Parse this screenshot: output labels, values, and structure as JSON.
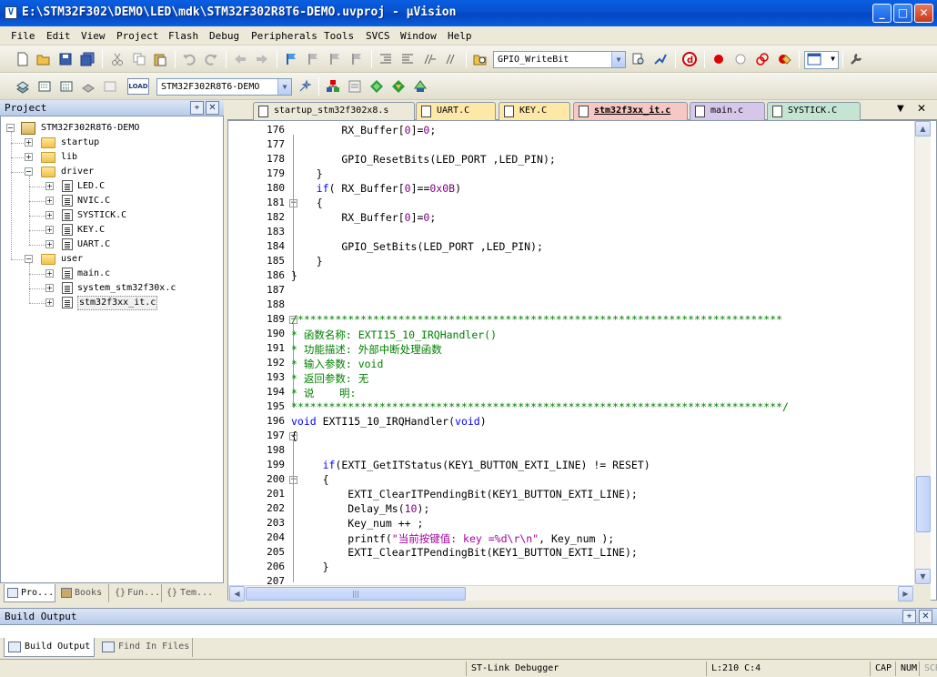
{
  "window": {
    "title": "E:\\STM32F302\\DEMO\\LED\\mdk\\STM32F302R8T6-DEMO.uvproj - µVision",
    "icon_letter": "V"
  },
  "menu": {
    "items": [
      {
        "label": "File"
      },
      {
        "label": "Edit"
      },
      {
        "label": "View"
      },
      {
        "label": "Project"
      },
      {
        "label": "Flash"
      },
      {
        "label": "Debug"
      },
      {
        "label": "Peripherals"
      },
      {
        "label": "Tools"
      },
      {
        "label": "SVCS"
      },
      {
        "label": "Window"
      },
      {
        "label": "Help"
      }
    ]
  },
  "toolbar": {
    "find_combo": "GPIO_WriteBit",
    "target_combo": "STM32F302R8T6-DEMO",
    "load_label": "LOAD"
  },
  "project_panel": {
    "title": "Project",
    "tree": {
      "root": "STM32F302R8T6-DEMO",
      "groups": [
        {
          "name": "startup",
          "expanded": false,
          "files": []
        },
        {
          "name": "lib",
          "expanded": false,
          "files": []
        },
        {
          "name": "driver",
          "expanded": true,
          "files": [
            "LED.C",
            "NVIC.C",
            "SYSTICK.C",
            "KEY.C",
            "UART.C"
          ]
        },
        {
          "name": "user",
          "expanded": true,
          "files": [
            "main.c",
            "system_stm32f30x.c",
            "stm32f3xx_it.c"
          ]
        }
      ]
    },
    "tabs": [
      {
        "label": "Pro..."
      },
      {
        "label": "Books"
      },
      {
        "label": "Fun..."
      },
      {
        "label": "Tem..."
      }
    ]
  },
  "editor": {
    "tabs": [
      {
        "label": "startup_stm32f302x8.s",
        "color": "#ece9d8"
      },
      {
        "label": "UART.C",
        "color": "#fde8a8"
      },
      {
        "label": "KEY.C",
        "color": "#fde8a8"
      },
      {
        "label": "stm32f3xx_it.c",
        "color": "#f7c7c3"
      },
      {
        "label": "main.c",
        "color": "#d6c7ea"
      },
      {
        "label": "SYSTICK.C",
        "color": "#c5e4d2"
      }
    ],
    "lines": [
      {
        "n": "176",
        "fold": "",
        "segs": [
          [
            "t",
            "        RX_Buffer["
          ],
          [
            "num",
            "0"
          ],
          [
            "t",
            "]="
          ],
          [
            "num",
            "0"
          ],
          [
            "t",
            ";"
          ]
        ]
      },
      {
        "n": "177",
        "fold": "",
        "segs": []
      },
      {
        "n": "178",
        "fold": "",
        "segs": [
          [
            "t",
            "        GPIO_ResetBits(LED_PORT ,LED_PIN);"
          ]
        ]
      },
      {
        "n": "179",
        "fold": "",
        "segs": [
          [
            "t",
            "    }"
          ]
        ]
      },
      {
        "n": "180",
        "fold": "",
        "segs": [
          [
            "t",
            "    "
          ],
          [
            "kw",
            "if"
          ],
          [
            "t",
            "( RX_Buffer["
          ],
          [
            "num",
            "0"
          ],
          [
            "t",
            "]=="
          ],
          [
            "num",
            "0x0B"
          ],
          [
            "t",
            ")"
          ]
        ]
      },
      {
        "n": "181",
        "fold": "-",
        "segs": [
          [
            "t",
            "    {"
          ]
        ]
      },
      {
        "n": "182",
        "fold": "",
        "segs": [
          [
            "t",
            "        RX_Buffer["
          ],
          [
            "num",
            "0"
          ],
          [
            "t",
            "]="
          ],
          [
            "num",
            "0"
          ],
          [
            "t",
            ";"
          ]
        ]
      },
      {
        "n": "183",
        "fold": "",
        "segs": []
      },
      {
        "n": "184",
        "fold": "",
        "segs": [
          [
            "t",
            "        GPIO_SetBits(LED_PORT ,LED_PIN);"
          ]
        ]
      },
      {
        "n": "185",
        "fold": "",
        "segs": [
          [
            "t",
            "    }"
          ]
        ]
      },
      {
        "n": "186",
        "fold": "",
        "segs": [
          [
            "t",
            "}"
          ]
        ]
      },
      {
        "n": "187",
        "fold": "",
        "segs": []
      },
      {
        "n": "188",
        "fold": "",
        "segs": []
      },
      {
        "n": "189",
        "fold": "-",
        "segs": [
          [
            "cm",
            "/*****************************************************************************"
          ]
        ]
      },
      {
        "n": "190",
        "fold": "",
        "segs": [
          [
            "cm",
            "* 函数名称: EXTI15_10_IRQHandler()"
          ]
        ]
      },
      {
        "n": "191",
        "fold": "",
        "segs": [
          [
            "cm",
            "* 功能描述: 外部中断处理函数"
          ]
        ]
      },
      {
        "n": "192",
        "fold": "",
        "segs": [
          [
            "cm",
            "* 输入参数: void"
          ]
        ]
      },
      {
        "n": "193",
        "fold": "",
        "segs": [
          [
            "cm",
            "* 返回参数: 无"
          ]
        ]
      },
      {
        "n": "194",
        "fold": "",
        "segs": [
          [
            "cm",
            "* 说    明:"
          ]
        ]
      },
      {
        "n": "195",
        "fold": "",
        "segs": [
          [
            "cm",
            "******************************************************************************/"
          ]
        ]
      },
      {
        "n": "196",
        "fold": "",
        "segs": [
          [
            "kw",
            "void"
          ],
          [
            "t",
            " EXTI15_10_IRQHandler("
          ],
          [
            "kw",
            "void"
          ],
          [
            "t",
            ")"
          ]
        ]
      },
      {
        "n": "197",
        "fold": "-",
        "segs": [
          [
            "t",
            "{"
          ]
        ]
      },
      {
        "n": "198",
        "fold": "",
        "segs": []
      },
      {
        "n": "199",
        "fold": "",
        "segs": [
          [
            "t",
            "     "
          ],
          [
            "kw",
            "if"
          ],
          [
            "t",
            "(EXTI_GetITStatus(KEY1_BUTTON_EXTI_LINE) != RESET)"
          ]
        ]
      },
      {
        "n": "200",
        "fold": "-",
        "segs": [
          [
            "t",
            "     {"
          ]
        ]
      },
      {
        "n": "201",
        "fold": "",
        "segs": [
          [
            "t",
            "         EXTI_ClearITPendingBit(KEY1_BUTTON_EXTI_LINE);"
          ]
        ]
      },
      {
        "n": "202",
        "fold": "",
        "segs": [
          [
            "t",
            "         Delay_Ms("
          ],
          [
            "num",
            "10"
          ],
          [
            "t",
            ");"
          ]
        ]
      },
      {
        "n": "203",
        "fold": "",
        "segs": [
          [
            "t",
            "         Key_num ++ ;"
          ]
        ]
      },
      {
        "n": "204",
        "fold": "",
        "segs": [
          [
            "t",
            "         printf("
          ],
          [
            "str",
            "\"当前按键值: key =%d\\r\\n\""
          ],
          [
            "t",
            ", Key_num );"
          ]
        ]
      },
      {
        "n": "205",
        "fold": "",
        "segs": [
          [
            "t",
            "         EXTI_ClearITPendingBit(KEY1_BUTTON_EXTI_LINE);"
          ]
        ]
      },
      {
        "n": "206",
        "fold": "",
        "segs": [
          [
            "t",
            "     }"
          ]
        ]
      },
      {
        "n": "207",
        "fold": "",
        "segs": []
      }
    ]
  },
  "build_output": {
    "title": "Build Output",
    "tabs": [
      {
        "label": "Build Output"
      },
      {
        "label": "Find In Files"
      }
    ]
  },
  "status": {
    "debugger": "ST-Link Debugger",
    "position": "L:210 C:4",
    "caps": "CAP",
    "num": "NUM",
    "scrl": "SCRL"
  }
}
